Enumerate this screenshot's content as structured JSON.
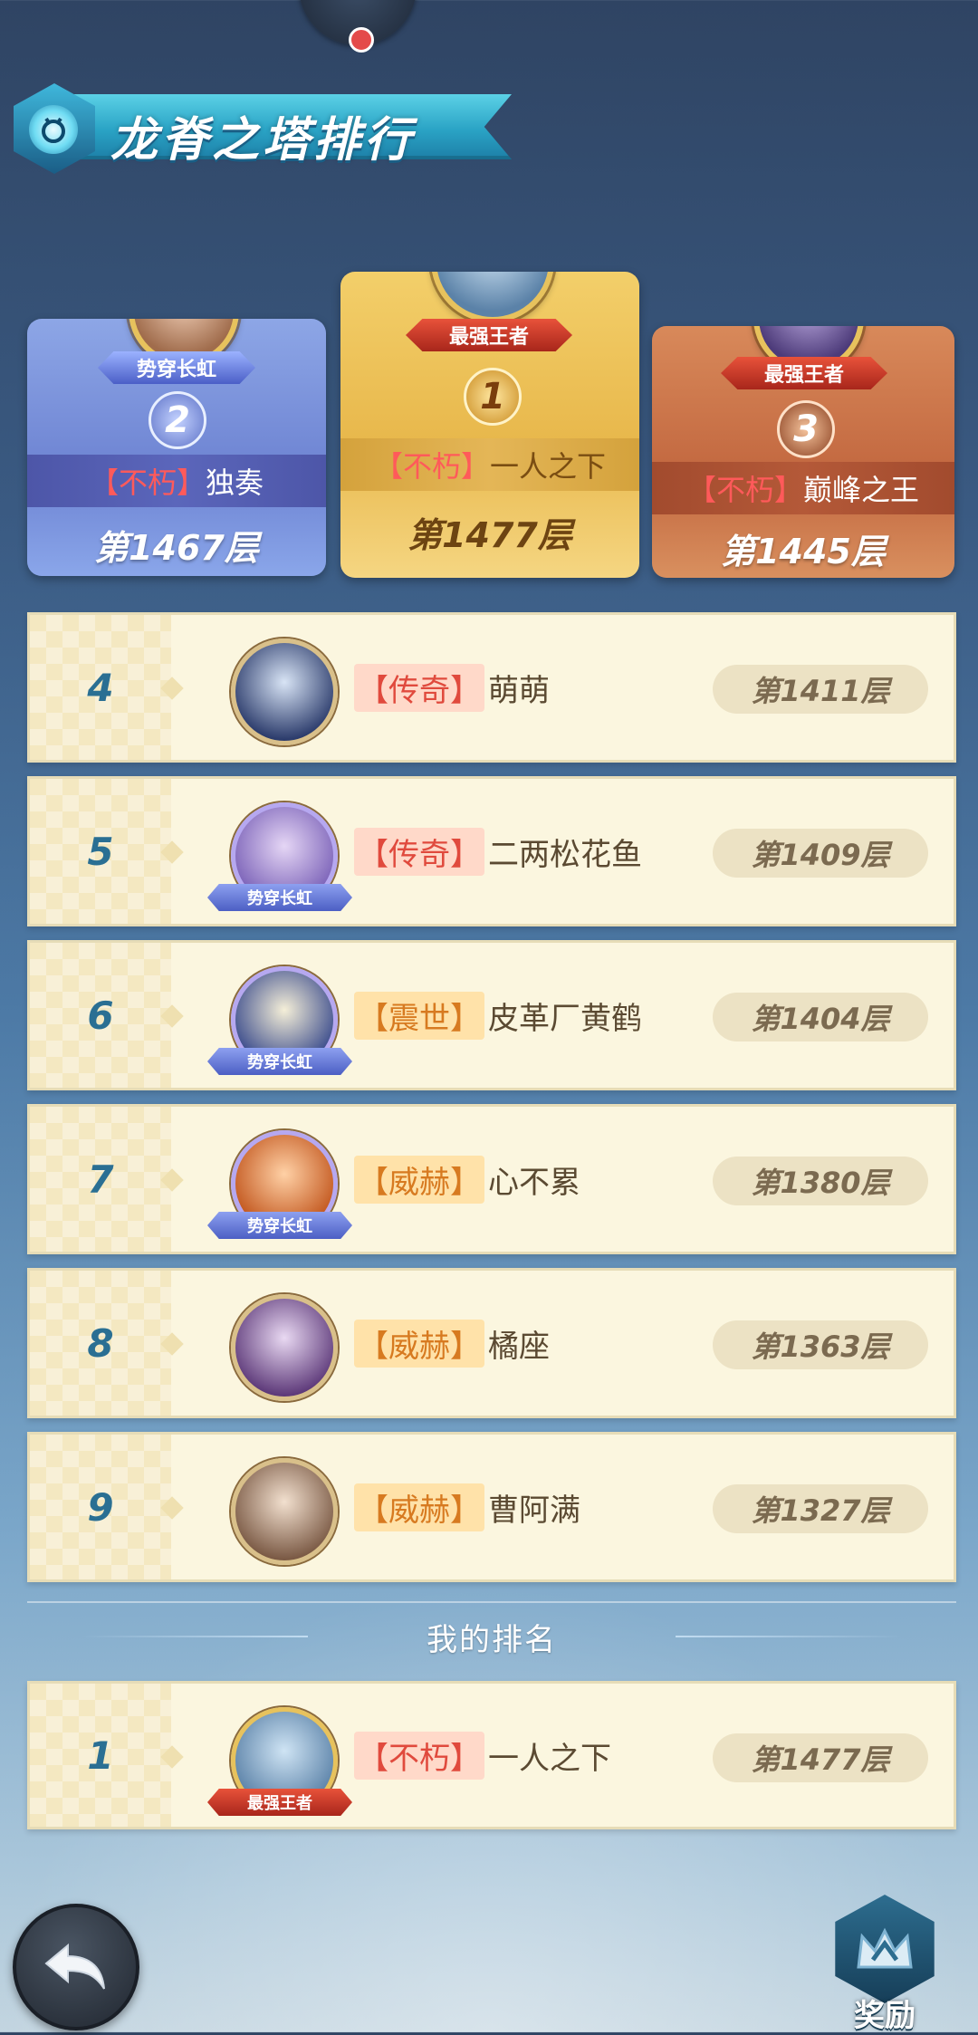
{
  "header": {
    "title": "龙脊之塔排行"
  },
  "podium": {
    "second": {
      "rank": "2",
      "title": "势穿长虹",
      "tag": "【不朽】",
      "name": "独奏",
      "floor": "第1467层"
    },
    "first": {
      "rank": "1",
      "title": "最强王者",
      "tag": "【不朽】",
      "name": "一人之下",
      "floor": "第1477层"
    },
    "third": {
      "rank": "3",
      "title": "最强王者",
      "tag": "【不朽】",
      "name": "巅峰之王",
      "floor": "第1445层"
    }
  },
  "rank_list": [
    {
      "rank": "4",
      "tag": "【传奇】",
      "name": "萌萌",
      "floor": "第1411层",
      "frame_label": ""
    },
    {
      "rank": "5",
      "tag": "【传奇】",
      "name": "二两松花鱼",
      "floor": "第1409层",
      "frame_label": "势穿长虹"
    },
    {
      "rank": "6",
      "tag": "【震世】",
      "name": "皮革厂黄鹤",
      "floor": "第1404层",
      "frame_label": "势穿长虹"
    },
    {
      "rank": "7",
      "tag": "【威赫】",
      "name": "心不累",
      "floor": "第1380层",
      "frame_label": "势穿长虹"
    },
    {
      "rank": "8",
      "tag": "【威赫】",
      "name": "橘座",
      "floor": "第1363层",
      "frame_label": ""
    },
    {
      "rank": "9",
      "tag": "【威赫】",
      "name": "曹阿满",
      "floor": "第1327层",
      "frame_label": ""
    }
  ],
  "my_rank": {
    "section_label": "我的排名",
    "rank": "1",
    "tag": "【不朽】",
    "name": "一人之下",
    "floor": "第1477层",
    "frame_label": "最强王者"
  },
  "footer": {
    "reward_label": "奖励"
  },
  "colors": {
    "accent_gold": "#e8b84c",
    "silver_blue": "#6d83d2",
    "bronze": "#c2673f",
    "rank_number": "#2a6f93",
    "row_bg": "#fbf6df"
  },
  "icons": {
    "back": "back-arrow-icon",
    "reward": "crown-icon",
    "title_emblem": "tower-emblem-icon"
  }
}
